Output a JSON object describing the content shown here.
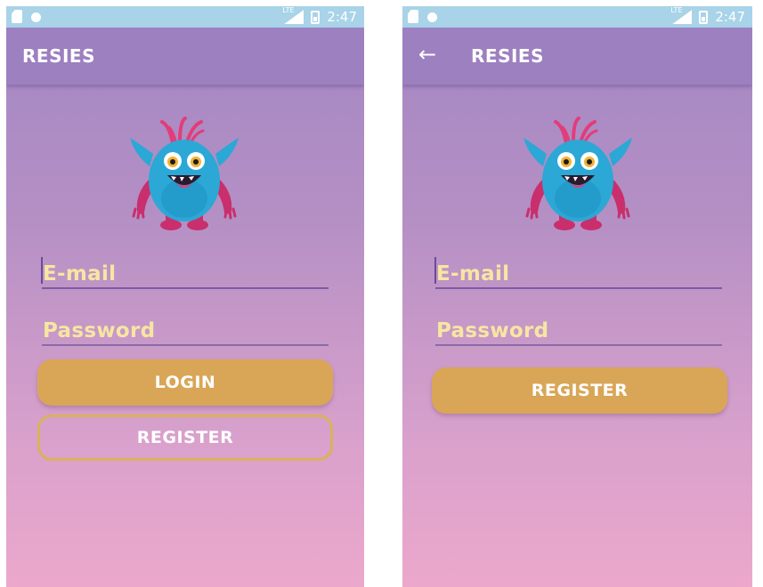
{
  "status_bar": {
    "time": "2:47",
    "network": "LTE"
  },
  "screens": {
    "login": {
      "app_title": "RESIES",
      "email_placeholder": "E-mail",
      "password_placeholder": "Password",
      "login_label": "LOGIN",
      "register_label": "REGISTER"
    },
    "register": {
      "app_title": "RESIES",
      "email_placeholder": "E-mail",
      "password_placeholder": "Password",
      "register_label": "REGISTER"
    }
  },
  "icons": {
    "back": "back-arrow-icon",
    "mascot": "monster-mascot-icon",
    "battery": "battery-icon",
    "signal": "signal-icon"
  },
  "colors": {
    "status_bar": "#a8d3e8",
    "app_bar": "#9d80c0",
    "accent": "#d9a657",
    "placeholder": "#f6e6a2",
    "gradient_top": "#a487c4",
    "gradient_bottom": "#eca8cc"
  }
}
